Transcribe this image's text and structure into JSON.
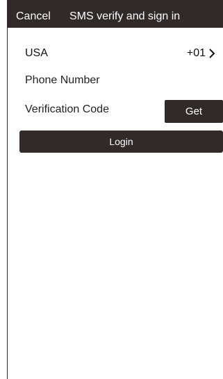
{
  "header": {
    "cancel_label": "Cancel",
    "title": "SMS verify and sign in"
  },
  "form": {
    "country_name": "USA",
    "country_code": "+01",
    "phone_placeholder": "Phone Number",
    "code_placeholder": "Verification Code",
    "get_label": "Get",
    "login_label": "Login"
  },
  "colors": {
    "header_bg": "#312a28",
    "button_bg": "#312a28",
    "text": "#111111"
  }
}
